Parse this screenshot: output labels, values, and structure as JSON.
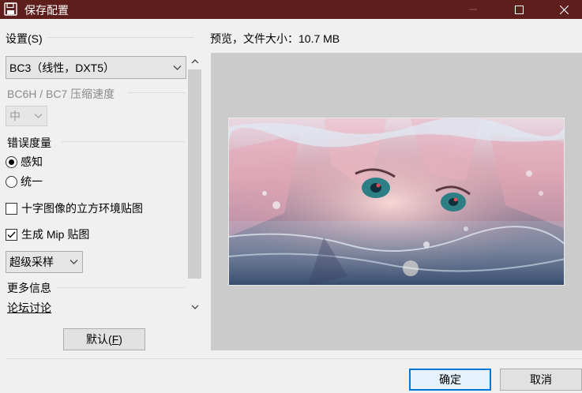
{
  "window": {
    "title": "保存配置",
    "icon": "floppy-disk-icon"
  },
  "left": {
    "header": "设置(S)",
    "format_select": "BC3（线性，DXT5）",
    "bc6_label": "BC6H / BC7 压缩速度",
    "speed_select": "中",
    "error_label": "错误度量",
    "radio_perceptual": "感知",
    "radio_uniform": "统一",
    "checkbox_cubemap": "十字图像的立方环境贴图",
    "checkbox_mipmap": "生成 Mip 贴图",
    "sample_select": "超级采样",
    "more_info": "更多信息",
    "forum_link": "论坛讨论",
    "default_button": "默认(",
    "default_mnemonic": "F",
    "default_button_end": ")"
  },
  "preview": {
    "label": "预览，文件大小：10.7 MB"
  },
  "buttons": {
    "ok": "确定",
    "cancel": "取消"
  },
  "state": {
    "radio_perceptual": true,
    "radio_uniform": false,
    "checkbox_cubemap": false,
    "checkbox_mipmap": true
  },
  "colors": {
    "titlebar": "#5e1e1c",
    "focus_border": "#0078d7",
    "preview_bg": "#cbcbcb"
  }
}
